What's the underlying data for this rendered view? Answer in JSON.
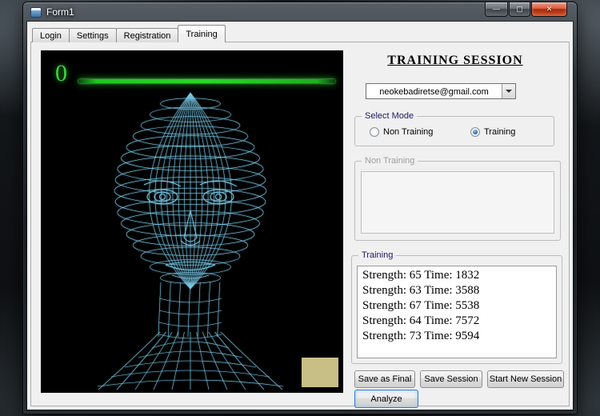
{
  "window": {
    "title": "Form1",
    "controls": {
      "minimize": "—",
      "maximize": "▢",
      "close": "✕"
    }
  },
  "tabs": {
    "items": [
      {
        "label": "Login"
      },
      {
        "label": "Settings"
      },
      {
        "label": "Registration"
      },
      {
        "label": "Training"
      }
    ],
    "active": "Training"
  },
  "viewer": {
    "counter": "0"
  },
  "session": {
    "heading": "TRAINING SESSION",
    "account_email": "neokebadiretse@gmail.com",
    "mode_group": {
      "label": "Select Mode",
      "options": [
        {
          "label": "Non Training",
          "selected": false
        },
        {
          "label": "Training",
          "selected": true
        }
      ]
    },
    "non_training": {
      "label": "Non Training",
      "content": ""
    },
    "training": {
      "label": "Training",
      "lines": [
        "Strength: 65 Time: 1832",
        "Strength: 63 Time: 3588",
        "Strength: 67 Time: 5538",
        "Strength: 64 Time: 7572",
        "Strength: 73 Time: 9594"
      ]
    },
    "actions": {
      "save_final": "Save as Final",
      "save_session": "Save Session",
      "start_new": "Start New Session",
      "analyze": "Analyze"
    }
  },
  "colors": {
    "wireframe": "#7fd0ee",
    "strength_line": "#2ad62a",
    "focus_accent": "#2e7cd1",
    "khaki_overlay": "#c8bf86"
  }
}
